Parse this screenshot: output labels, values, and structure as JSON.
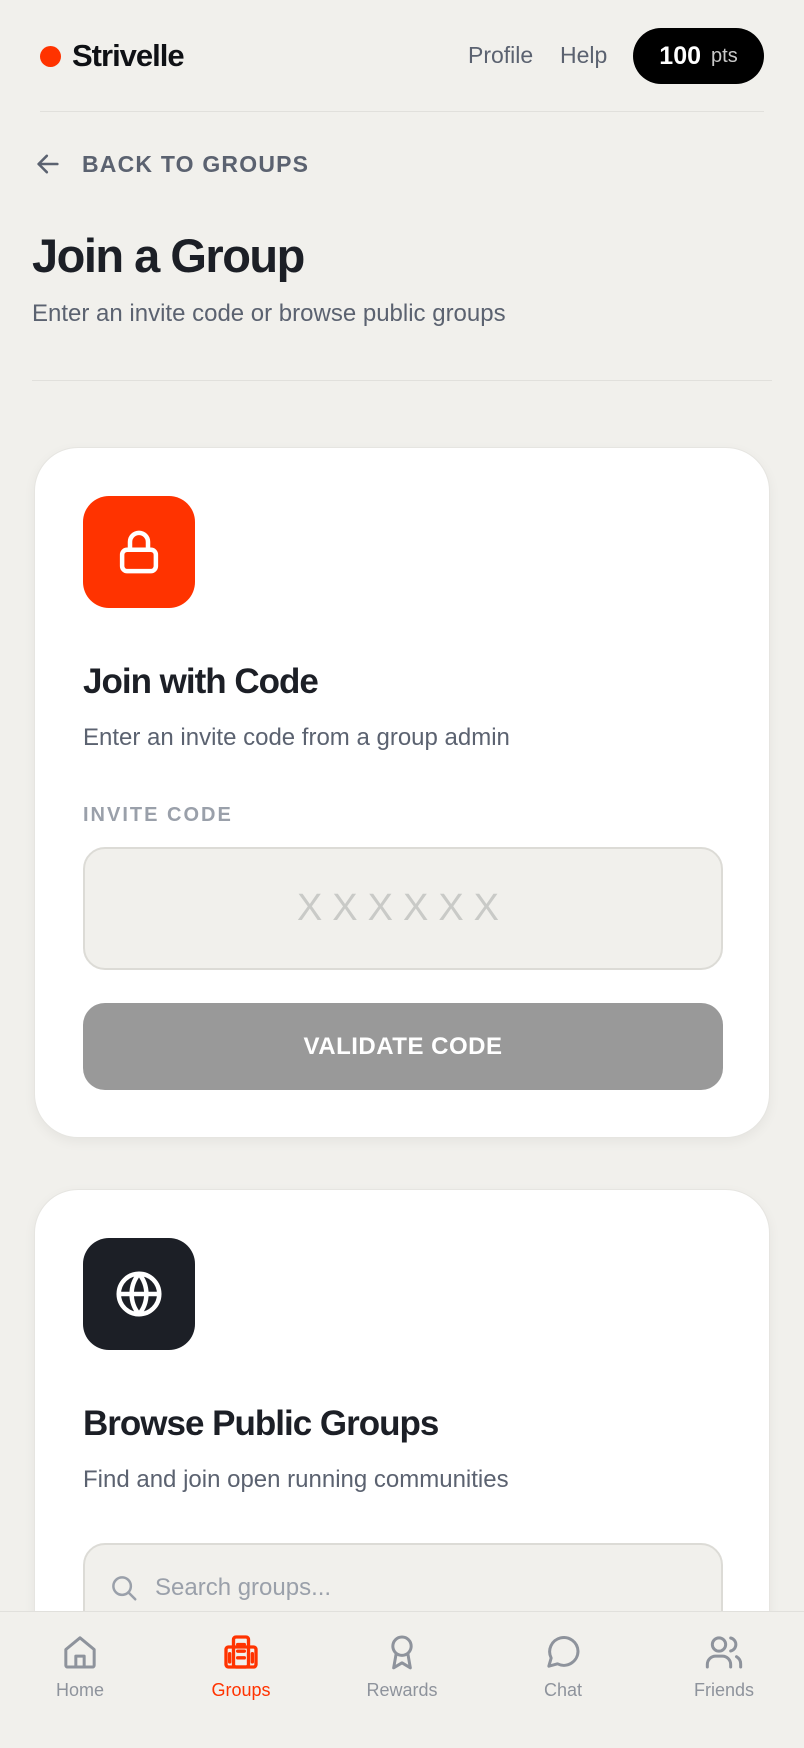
{
  "header": {
    "brand": "Strivelle",
    "nav": {
      "profile": "Profile",
      "help": "Help"
    },
    "points": {
      "value": "100",
      "unit": "pts"
    }
  },
  "back": {
    "label": "BACK TO GROUPS",
    "icon": "arrow-left-icon"
  },
  "page": {
    "title": "Join a Group",
    "subtitle": "Enter an invite code or browse public groups"
  },
  "join_code": {
    "icon": "lock-icon",
    "title": "Join with Code",
    "subtitle": "Enter an invite code from a group admin",
    "field_label": "INVITE CODE",
    "input_placeholder": "XXXXXX",
    "button_label": "VALIDATE CODE"
  },
  "browse": {
    "icon": "globe-icon",
    "title": "Browse Public Groups",
    "subtitle": "Find and join open running communities",
    "search_placeholder": "Search groups..."
  },
  "bottom_nav": {
    "items": [
      {
        "label": "Home",
        "icon": "home-icon",
        "active": false
      },
      {
        "label": "Groups",
        "icon": "groups-icon",
        "active": true
      },
      {
        "label": "Rewards",
        "icon": "award-icon",
        "active": false
      },
      {
        "label": "Chat",
        "icon": "chat-icon",
        "active": false
      },
      {
        "label": "Friends",
        "icon": "friends-icon",
        "active": false
      }
    ]
  },
  "colors": {
    "accent": "#ff3300",
    "background": "#f1f0ec",
    "dark": "#1c1f26",
    "muted": "#5b6270",
    "disabled_button": "#999999"
  }
}
